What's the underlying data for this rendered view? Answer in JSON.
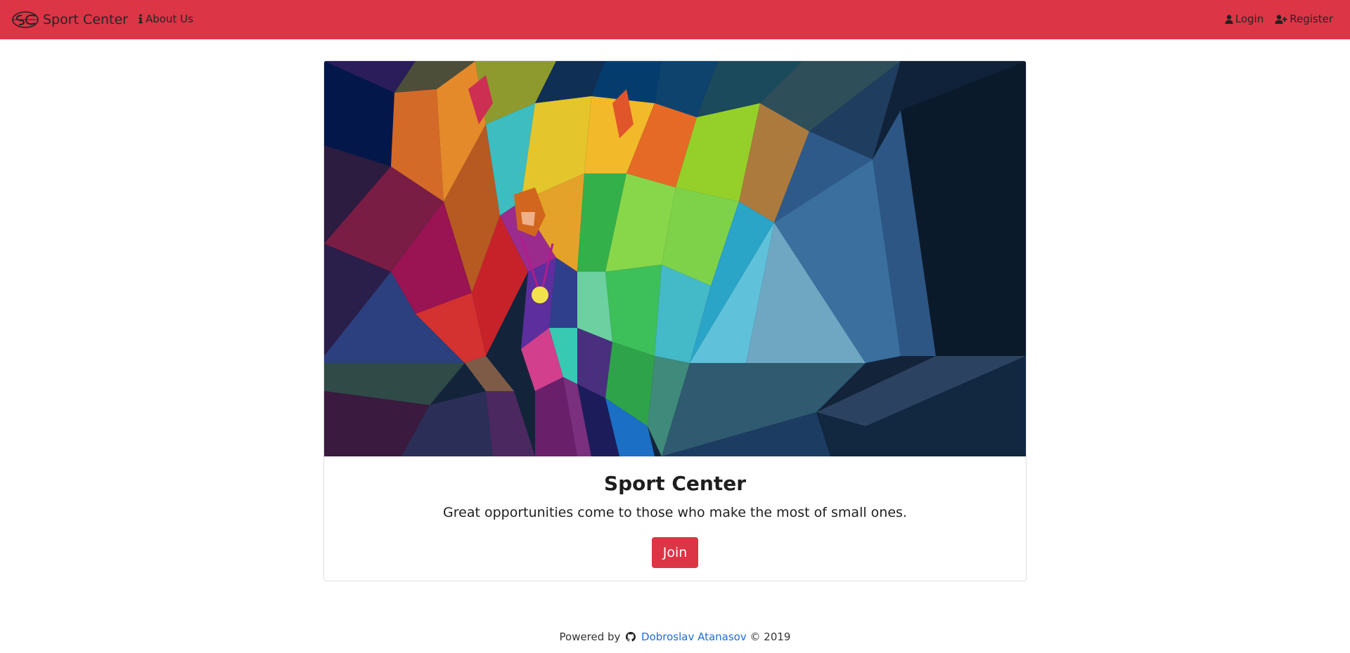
{
  "navbar": {
    "brand_text": "Sport Center",
    "logo_icon": "sc-monogram-logo",
    "about_label": "About Us",
    "about_icon": "info-icon",
    "login_label": "Login",
    "login_icon": "user-icon",
    "register_label": "Register",
    "register_icon": "user-plus-icon",
    "bg_color": "#dc3545"
  },
  "hero": {
    "image": "low-poly-athlete-with-gold-medal"
  },
  "card": {
    "title": "Sport Center",
    "text": "Great opportunities come to those who make the most of small ones.",
    "join_label": "Join"
  },
  "footer": {
    "powered_by": "Powered by",
    "github_icon": "github-icon",
    "author": "Dobroslav Atanasov",
    "copyright": "© 2019"
  },
  "colors": {
    "accent": "#dc3545",
    "link": "#1c6fd4"
  }
}
